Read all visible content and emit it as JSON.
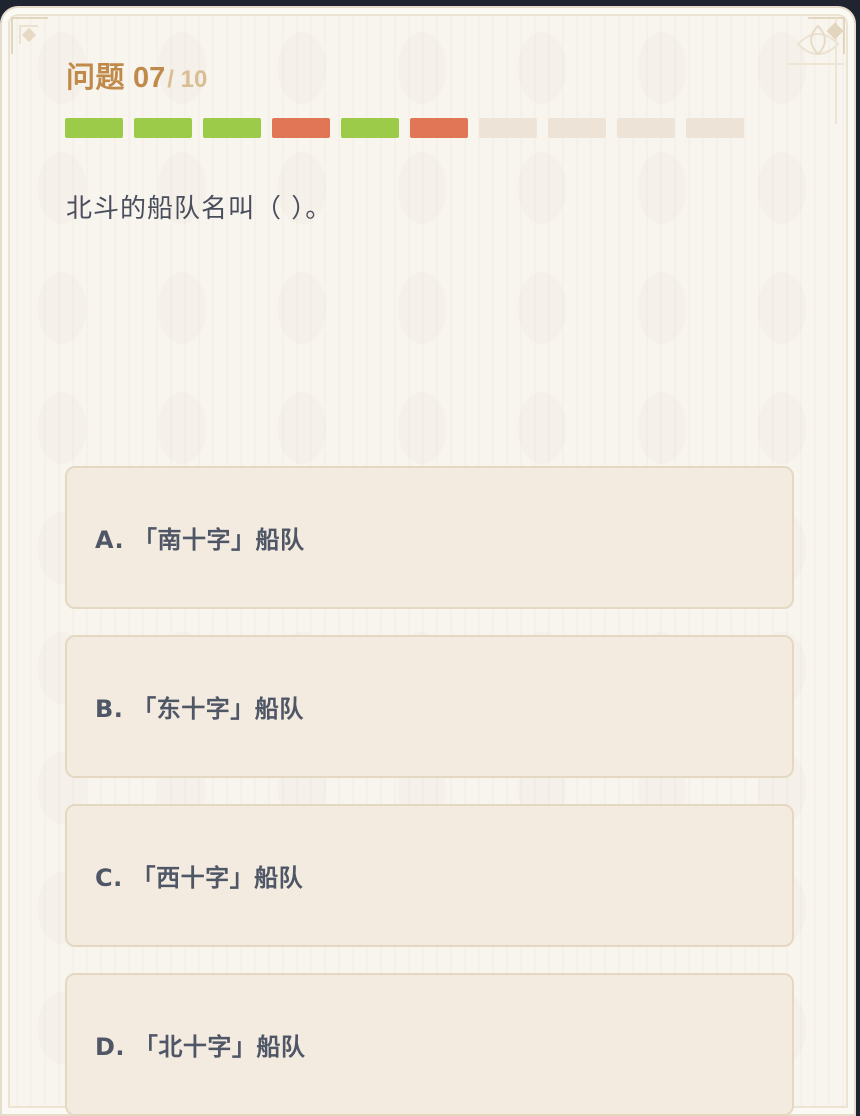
{
  "quiz": {
    "label": "问题",
    "current": "07",
    "total": "/ 10",
    "progress": [
      "correct",
      "correct",
      "correct",
      "wrong",
      "correct",
      "wrong",
      "pending",
      "pending",
      "pending",
      "pending"
    ],
    "question": "北斗的船队名叫（ ）。"
  },
  "options": [
    {
      "text": "A. 「南十字」船队"
    },
    {
      "text": "B. 「东十字」船队"
    },
    {
      "text": "C. 「西十字」船队"
    },
    {
      "text": "D. 「北十字」船队"
    }
  ],
  "colors": {
    "correct": "#9ccb49",
    "wrong": "#e17657",
    "pending": "#ede3d6",
    "accent": "#c08b4a"
  }
}
